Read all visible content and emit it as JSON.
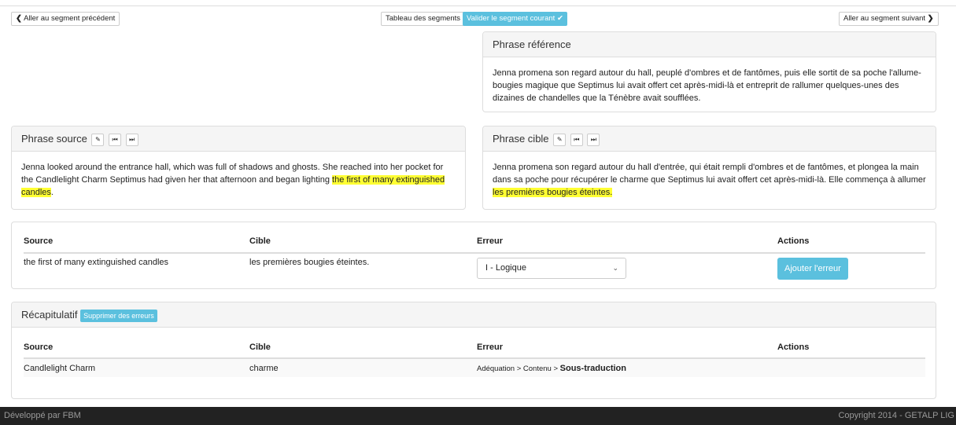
{
  "nav": {
    "prev_label": "Aller au segment précédent",
    "table_label": "Tableau des segments",
    "validate_label": "Valider le segment courant",
    "next_label": "Aller au segment suivant"
  },
  "reference": {
    "heading": "Phrase référence",
    "text": "Jenna promena son regard autour du hall, peuplé d'ombres et de fantômes, puis elle sortit de sa poche l'allume-bougies magique que Septimus lui avait offert cet après-midi-là et entreprit de rallumer quelques-unes des dizaines de chandelles que la Ténèbre avait soufflées."
  },
  "source": {
    "heading": "Phrase source",
    "text_before": "Jenna looked around the entrance hall, which was full of shadows and ghosts. She reached into her pocket for the Candlelight Charm Septimus had given her that afternoon and began lighting ",
    "text_highlight": "the first of many extinguished candles",
    "text_after": "."
  },
  "target": {
    "heading": "Phrase cible",
    "text_before": "Jenna promena son regard autour du hall d'entrée, qui était rempli d'ombres et de fantômes, et plongea la main dans sa poche pour récupérer le charme que Septimus lui avait offert cet après-midi-là. Elle commença à allumer ",
    "text_highlight": "les premières bougies éteintes.",
    "text_after": ""
  },
  "error_form": {
    "headers": {
      "source": "Source",
      "cible": "Cible",
      "erreur": "Erreur",
      "actions": "Actions"
    },
    "row": {
      "source": "the first of many extinguished candles",
      "cible": "les premières bougies éteintes.",
      "erreur_selected": "I - Logique",
      "add_label": "Ajouter l'erreur"
    }
  },
  "summary": {
    "heading": "Récapitulatif",
    "delete_label": "Supprimer des erreurs",
    "headers": {
      "source": "Source",
      "cible": "Cible",
      "erreur": "Erreur",
      "actions": "Actions"
    },
    "rows": [
      {
        "source": "Candlelight Charm",
        "cible": "charme",
        "erreur_path": "Adéquation > Contenu > ",
        "erreur_leaf": "Sous-traduction"
      }
    ]
  },
  "footer": {
    "left": "Développé par FBM",
    "right": "Copyright 2014 - GETALP LIG"
  },
  "colors": {
    "info": "#5bc0de",
    "highlight": "#ffff33",
    "footer_bg": "#222222"
  }
}
